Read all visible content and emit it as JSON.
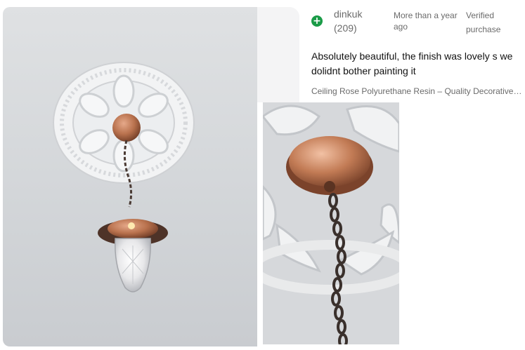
{
  "review": {
    "username": "dinkuk",
    "rating_count": "(209)",
    "time_ago": "More than a year ago",
    "verified": "Verified purchase",
    "verified_icon": "plus-circle-icon",
    "text": "Absolutely beautiful, the finish was lovely s we dolidnt bother painting it",
    "item_title": "Ceiling Rose Polyurethane Resin – Quality Decorative…"
  },
  "colors": {
    "positive_green": "#1a9b47",
    "muted_text": "#6b6b6b",
    "body_text": "#111111",
    "copper": "#b8714d"
  }
}
